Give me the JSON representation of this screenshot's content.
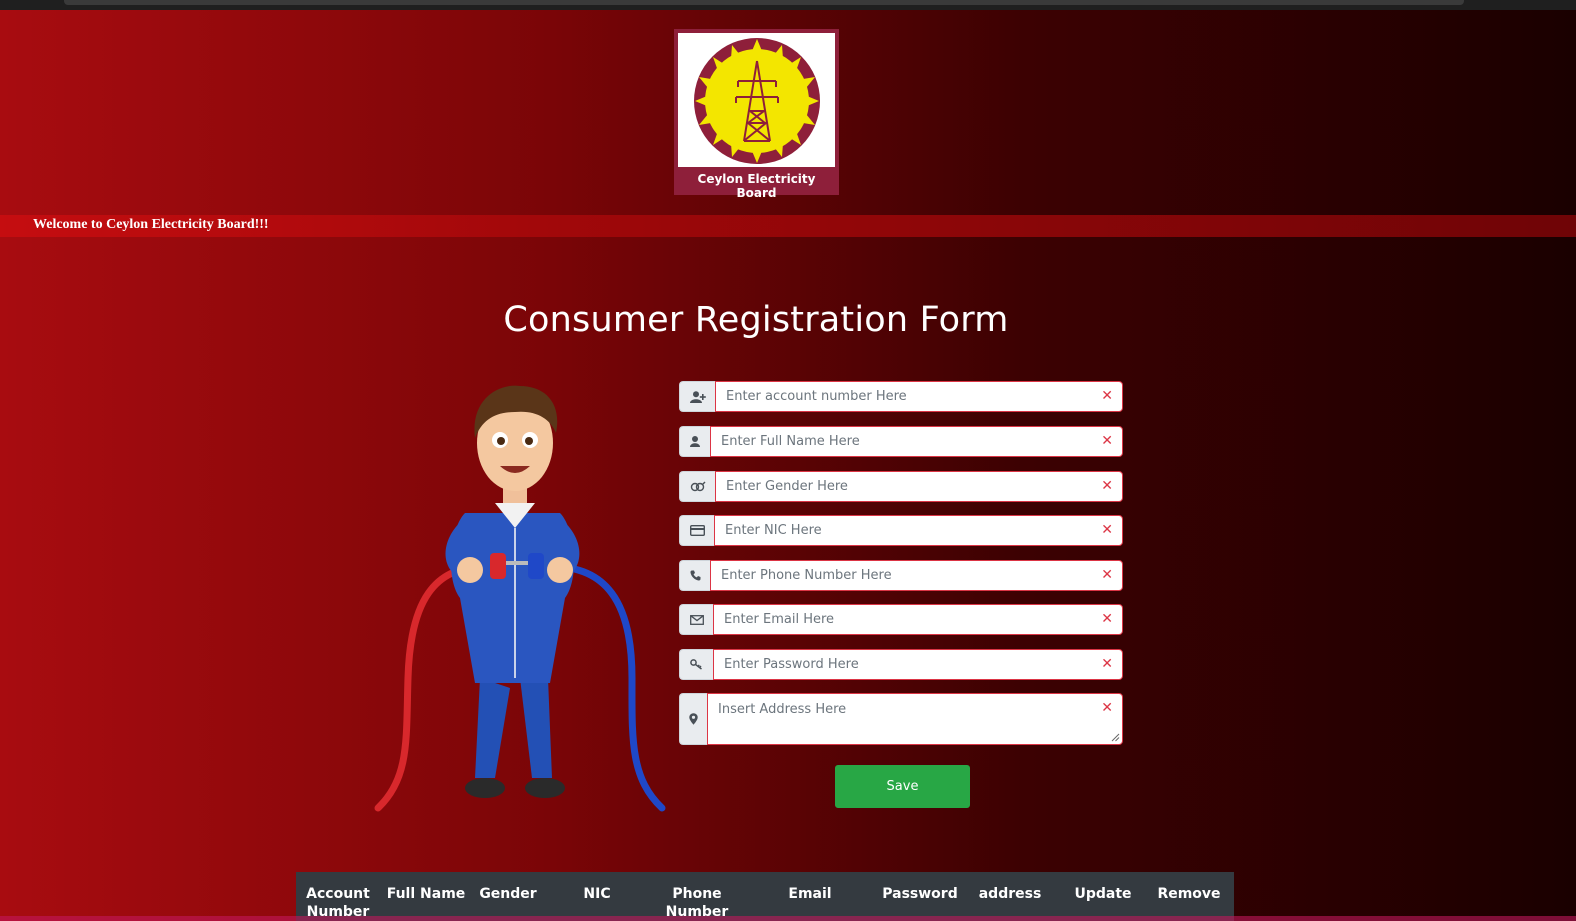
{
  "logo": {
    "caption": "Ceylon Electricity Board"
  },
  "welcome": "Welcome to Ceylon Electricity Board!!!",
  "title": "Consumer Registration Form",
  "form": {
    "fields": [
      {
        "icon": "user-plus-icon",
        "placeholder": "Enter account number Here"
      },
      {
        "icon": "user-icon",
        "placeholder": "Enter Full Name Here"
      },
      {
        "icon": "gender-icon",
        "placeholder": "Enter Gender Here"
      },
      {
        "icon": "id-card-icon",
        "placeholder": "Enter NIC Here"
      },
      {
        "icon": "phone-icon",
        "placeholder": "Enter Phone Number Here"
      },
      {
        "icon": "envelope-icon",
        "placeholder": "Enter Email Here"
      },
      {
        "icon": "key-icon",
        "placeholder": "Enter Password Here"
      },
      {
        "icon": "map-marker-icon",
        "placeholder": "Insert Address Here"
      }
    ],
    "invalid_mark": "✕",
    "save_label": "Save"
  },
  "table": {
    "headers": [
      "Account Number",
      "Full Name",
      "Gender",
      "NIC",
      "Phone Number",
      "Email",
      "Password",
      "address",
      "Update",
      "Remove"
    ]
  },
  "colors": {
    "save_button": "#28a745",
    "invalid_border": "#dc3545",
    "table_header": "#343a40"
  }
}
